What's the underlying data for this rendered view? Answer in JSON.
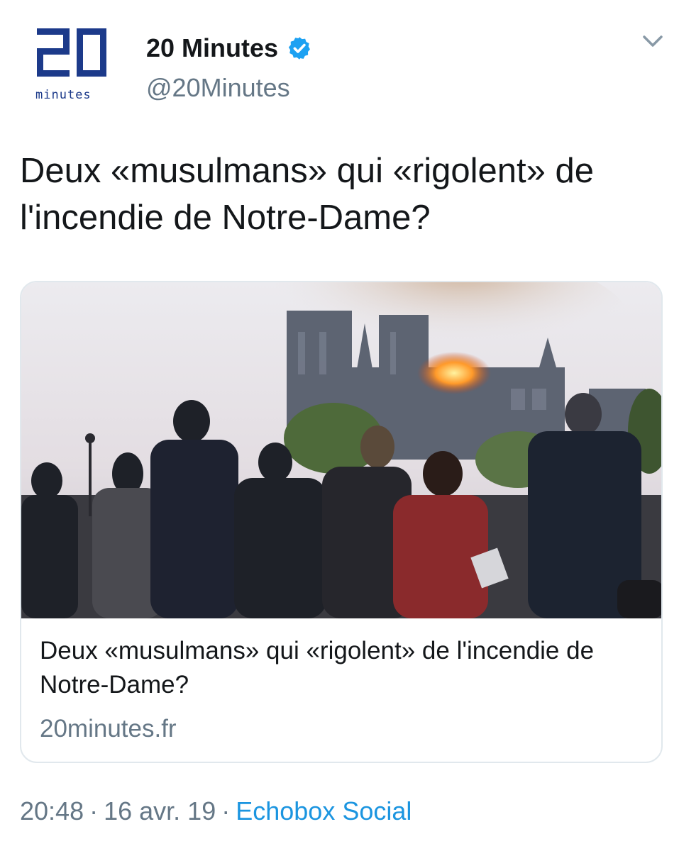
{
  "account": {
    "logo_text": "minutes",
    "display_name": "20 Minutes",
    "handle": "@20Minutes"
  },
  "tweet": {
    "text": "Deux «musulmans» qui «rigolent» de l'incendie de Notre-Dame?"
  },
  "card": {
    "title": "Deux «musulmans» qui «rigolent» de l'incendie de Notre-Dame?",
    "domain": "20minutes.fr"
  },
  "meta": {
    "time": "20:48",
    "date": "16 avr. 19",
    "separator": "·",
    "source": "Echobox Social"
  },
  "colors": {
    "brand_blue": "#1c3a8a",
    "verified_blue": "#1da1f2",
    "link_blue": "#1b95e0",
    "muted_gray": "#657786",
    "card_border": "#e1e8ed"
  },
  "icons": {
    "verified": "verified-badge-icon",
    "menu": "chevron-down-icon"
  }
}
